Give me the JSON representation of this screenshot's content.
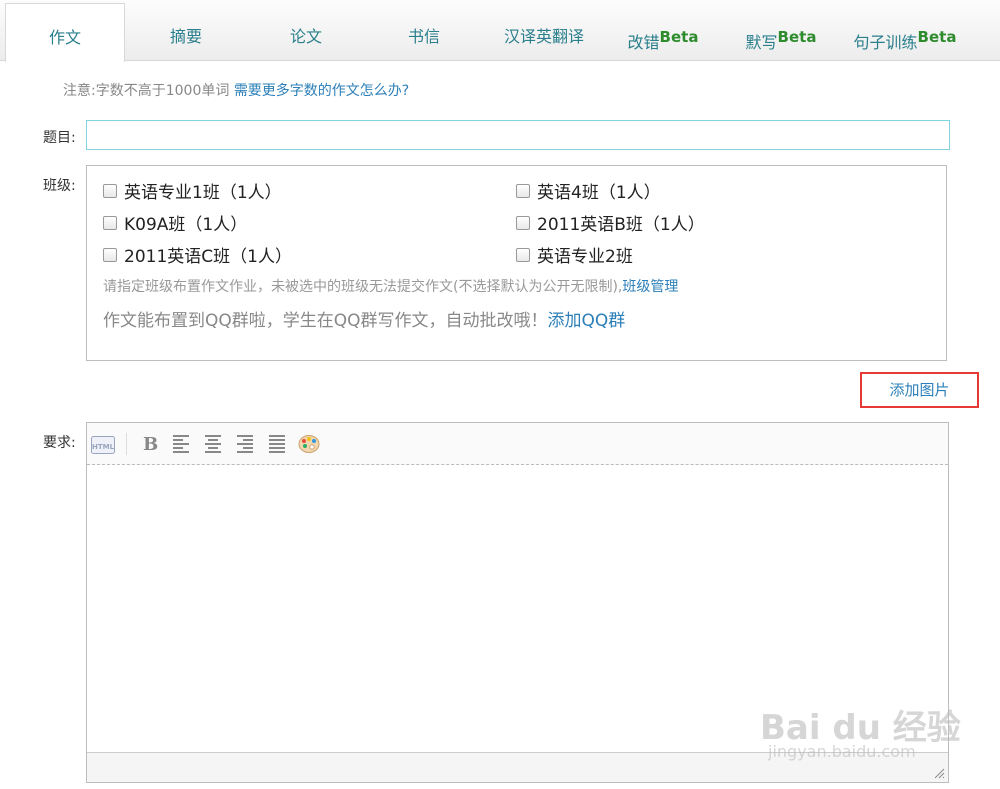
{
  "tabs": [
    {
      "label": "作文",
      "beta": ""
    },
    {
      "label": "摘要",
      "beta": ""
    },
    {
      "label": "论文",
      "beta": ""
    },
    {
      "label": "书信",
      "beta": ""
    },
    {
      "label": "汉译英翻译",
      "beta": ""
    },
    {
      "label": "改错",
      "beta": "Beta"
    },
    {
      "label": "默写",
      "beta": "Beta"
    },
    {
      "label": "句子训练",
      "beta": "Beta"
    }
  ],
  "notice": {
    "text": "注意:字数不高于1000单词",
    "link": "需要更多字数的作文怎么办?"
  },
  "form": {
    "title_label": "题目:",
    "title_value": "",
    "class_label": "班级:",
    "requirement_label": "要求:"
  },
  "classes": [
    "英语专业1班（1人）",
    "英语4班（1人）",
    "K09A班（1人）",
    "2011英语B班（1人）",
    "2011英语C班（1人）",
    "英语专业2班"
  ],
  "class_hint": {
    "text": "请指定班级布置作文作业，未被选中的班级无法提交作文(不选择默认为公开无限制),",
    "link": "班级管理"
  },
  "qq_hint": {
    "text": "作文能布置到QQ群啦，学生在QQ群写作文，自动批改哦！",
    "link": "添加QQ群"
  },
  "add_image_label": "添加图片",
  "toolbar": {
    "html_label": "HTML",
    "bold_label": "B"
  },
  "watermark": {
    "logo": "Bai du 经验",
    "url": "jingyan.baidu.com"
  },
  "colors": {
    "tab_text": "#2a7f8c",
    "beta": "#2e8b2e",
    "link": "#2c7fb8",
    "highlight_border": "#e53935"
  }
}
